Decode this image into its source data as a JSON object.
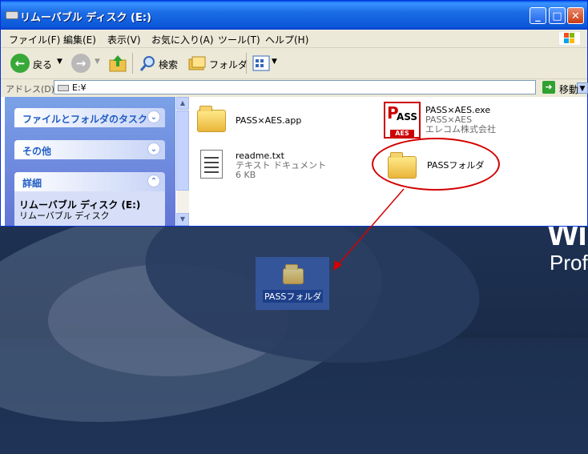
{
  "window": {
    "title": "リムーバブル ディスク (E:)",
    "menu": [
      "ファイル(F)",
      "編集(E)",
      "表示(V)",
      "お気に入り(A)",
      "ツール(T)",
      "ヘルプ(H)"
    ],
    "controls": {
      "minimize": "_",
      "maximize": "□",
      "close": "✕"
    }
  },
  "toolbar": {
    "back_label": "戻る",
    "search_label": "検索",
    "folders_label": "フォルダ"
  },
  "address": {
    "label": "アドレス(D)",
    "value": "E:¥",
    "go_label": "移動"
  },
  "taskpane": {
    "sections": [
      {
        "title": "ファイルとフォルダのタスク",
        "chevron": "⌄"
      },
      {
        "title": "その他",
        "chevron": "⌄"
      },
      {
        "title": "詳細",
        "chevron": "⌃"
      }
    ],
    "details": {
      "name": "リムーバブル ディスク (E:)",
      "type": "リムーバブル ディスク"
    }
  },
  "files": [
    {
      "name": "PASS×AES.app",
      "kind": "folder"
    },
    {
      "name": "PASS×AES.exe",
      "line2": "PASS×AES",
      "line3": "エレコム株式会社",
      "kind": "exe"
    },
    {
      "name": "readme.txt",
      "line2": "テキスト ドキュメント",
      "line3": "6 KB",
      "kind": "text"
    },
    {
      "name": "PASSフォルダ",
      "kind": "folder"
    }
  ],
  "desktop": {
    "folder_label": "PASSフォルダ",
    "brand_big": "Wi",
    "brand_small": "Prof"
  },
  "colors": {
    "highlight": "#d40000",
    "accent": "#0b57d8"
  },
  "icons": {
    "pass_logo": {
      "top": "P",
      "mid": "ASS",
      "bottom": "AES"
    }
  }
}
